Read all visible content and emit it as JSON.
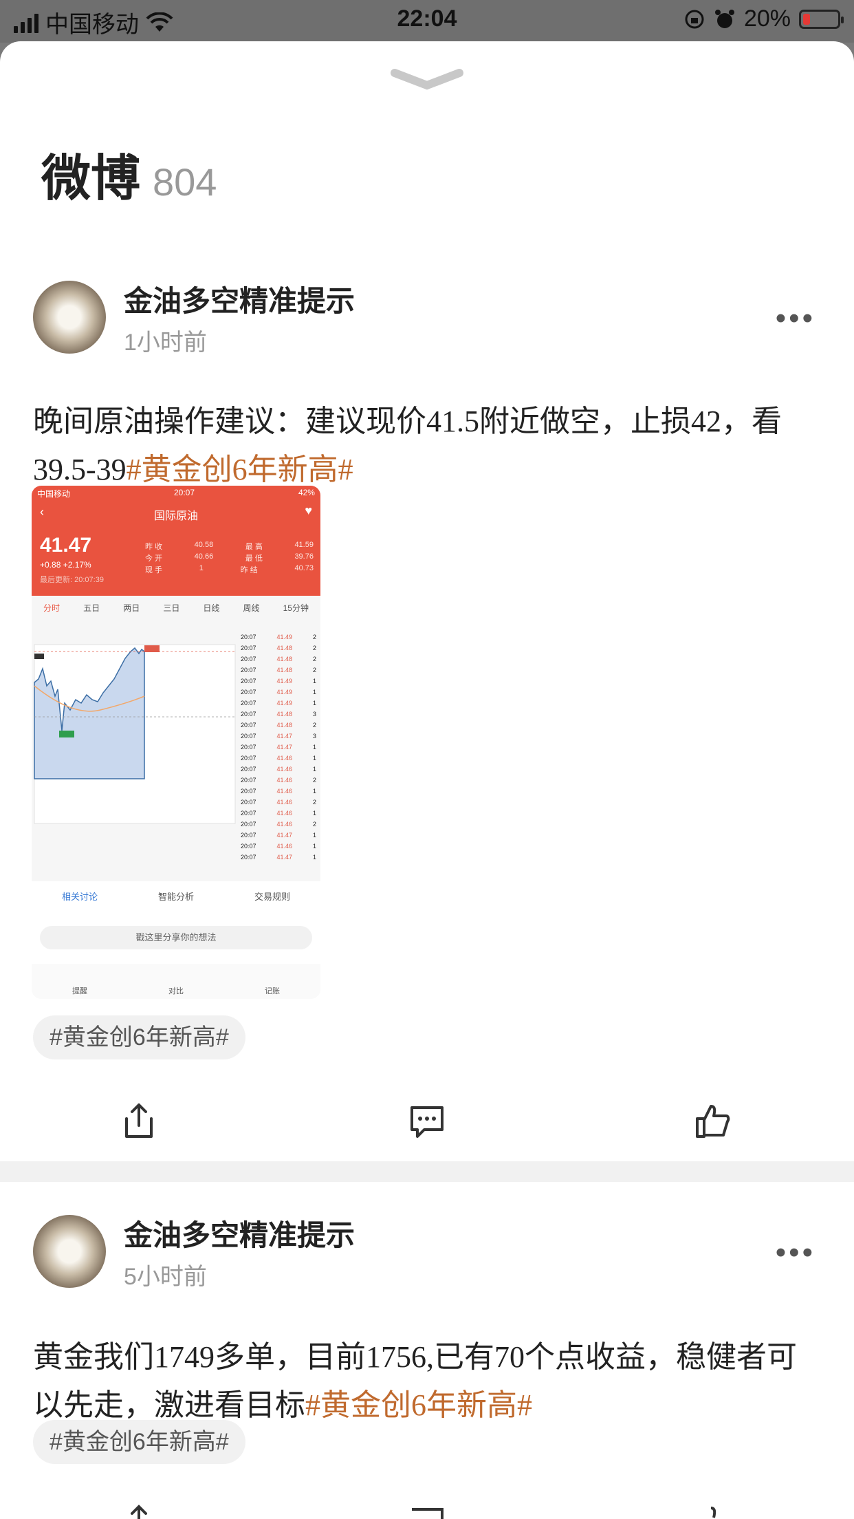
{
  "status_bar": {
    "carrier": "中国移动",
    "time": "22:04",
    "battery": "20%"
  },
  "sheet": {
    "title": "微博",
    "count": "804"
  },
  "posts": [
    {
      "author": "金油多空精准提示",
      "time": "1小时前",
      "text": "晚间原油操作建议：建议现价41.5附近做空，止损42，看39.5-39",
      "hashtag": "#黄金创6年新高#",
      "chip": "#黄金创6年新高#"
    },
    {
      "author": "金油多空精准提示",
      "time": "5小时前",
      "text": "黄金我们1749多单，目前1756,已有70个点收益，稳健者可以先走，激进看目标",
      "hashtag": "#黄金创6年新高#",
      "chip": "#黄金创6年新高#"
    }
  ],
  "embedded": {
    "status": {
      "carrier": "中国移动",
      "time": "20:07",
      "battery": "42%"
    },
    "title": "国际原油",
    "price": "41.47",
    "change": "+0.88  +2.17%",
    "updated": "最后更新: 20:07:39",
    "stats": [
      {
        "k1": "昨 收",
        "v1": "40.58",
        "k2": "最 高",
        "v2": "41.59"
      },
      {
        "k1": "今 开",
        "v1": "40.66",
        "k2": "最 低",
        "v2": "39.76"
      },
      {
        "k1": "现 手",
        "v1": "1",
        "k2": "昨 结",
        "v2": "40.73"
      }
    ],
    "tabs": [
      "分时",
      "五日",
      "两日",
      "三日",
      "日线",
      "周线",
      "15分钟"
    ],
    "ticks": [
      {
        "t": "20:07",
        "p": "41.49",
        "v": "2"
      },
      {
        "t": "20:07",
        "p": "41.48",
        "v": "2"
      },
      {
        "t": "20:07",
        "p": "41.48",
        "v": "2"
      },
      {
        "t": "20:07",
        "p": "41.48",
        "v": "2"
      },
      {
        "t": "20:07",
        "p": "41.49",
        "v": "1"
      },
      {
        "t": "20:07",
        "p": "41.49",
        "v": "1"
      },
      {
        "t": "20:07",
        "p": "41.49",
        "v": "1"
      },
      {
        "t": "20:07",
        "p": "41.48",
        "v": "3"
      },
      {
        "t": "20:07",
        "p": "41.48",
        "v": "2"
      },
      {
        "t": "20:07",
        "p": "41.47",
        "v": "3"
      },
      {
        "t": "20:07",
        "p": "41.47",
        "v": "1"
      },
      {
        "t": "20:07",
        "p": "41.46",
        "v": "1"
      },
      {
        "t": "20:07",
        "p": "41.46",
        "v": "1"
      },
      {
        "t": "20:07",
        "p": "41.46",
        "v": "2"
      },
      {
        "t": "20:07",
        "p": "41.46",
        "v": "1"
      },
      {
        "t": "20:07",
        "p": "41.46",
        "v": "2"
      },
      {
        "t": "20:07",
        "p": "41.46",
        "v": "1"
      },
      {
        "t": "20:07",
        "p": "41.46",
        "v": "2"
      },
      {
        "t": "20:07",
        "p": "41.47",
        "v": "1"
      },
      {
        "t": "20:07",
        "p": "41.46",
        "v": "1"
      },
      {
        "t": "20:07",
        "p": "41.47",
        "v": "1"
      }
    ],
    "bottom_tabs": [
      "相关讨论",
      "智能分析",
      "交易规则"
    ],
    "input_placeholder": "戳这里分享你的想法",
    "dock": [
      "提醒",
      "对比",
      "记账"
    ]
  }
}
